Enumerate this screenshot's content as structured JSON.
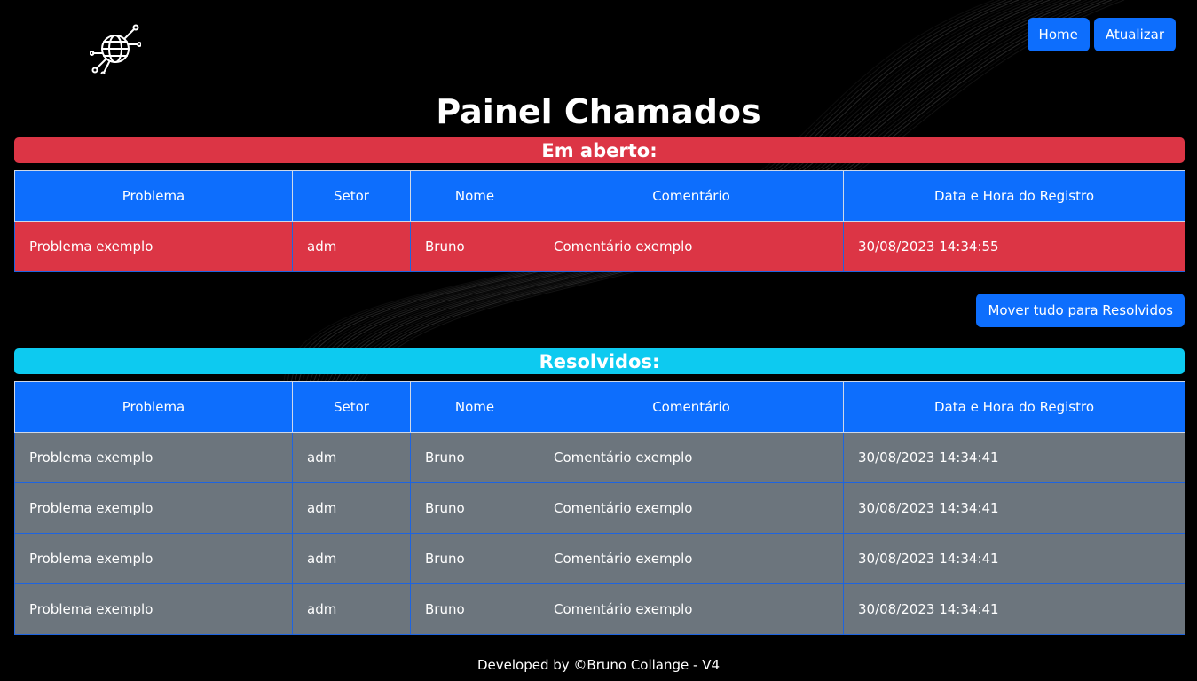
{
  "header": {
    "nav": [
      {
        "label": "Home"
      },
      {
        "label": "Atualizar"
      }
    ]
  },
  "page_title": "Painel Chamados",
  "open_section": {
    "heading": "Em aberto:",
    "columns": [
      "Problema",
      "Setor",
      "Nome",
      "Comentário",
      "Data e Hora do Registro"
    ],
    "rows": [
      {
        "problema": "Problema exemplo",
        "setor": "adm",
        "nome": "Bruno",
        "comentario": "Comentário exemplo",
        "data_hora": "30/08/2023 14:34:55"
      }
    ],
    "move_all_label": "Mover tudo para Resolvidos"
  },
  "resolved_section": {
    "heading": "Resolvidos:",
    "columns": [
      "Problema",
      "Setor",
      "Nome",
      "Comentário",
      "Data e Hora do Registro"
    ],
    "rows": [
      {
        "problema": "Problema exemplo",
        "setor": "adm",
        "nome": "Bruno",
        "comentario": "Comentário exemplo",
        "data_hora": "30/08/2023 14:34:41"
      },
      {
        "problema": "Problema exemplo",
        "setor": "adm",
        "nome": "Bruno",
        "comentario": "Comentário exemplo",
        "data_hora": "30/08/2023 14:34:41"
      },
      {
        "problema": "Problema exemplo",
        "setor": "adm",
        "nome": "Bruno",
        "comentario": "Comentário exemplo",
        "data_hora": "30/08/2023 14:34:41"
      },
      {
        "problema": "Problema exemplo",
        "setor": "adm",
        "nome": "Bruno",
        "comentario": "Comentário exemplo",
        "data_hora": "30/08/2023 14:34:41"
      }
    ]
  },
  "footer": "Developed by ©Bruno Collange - V4",
  "icons": {
    "logo": "globe-circuit-icon"
  },
  "colors": {
    "background": "#000000",
    "primary": "#0d6efd",
    "danger": "#dc3545",
    "info": "#0dcaf0",
    "secondary": "#6c757d"
  }
}
